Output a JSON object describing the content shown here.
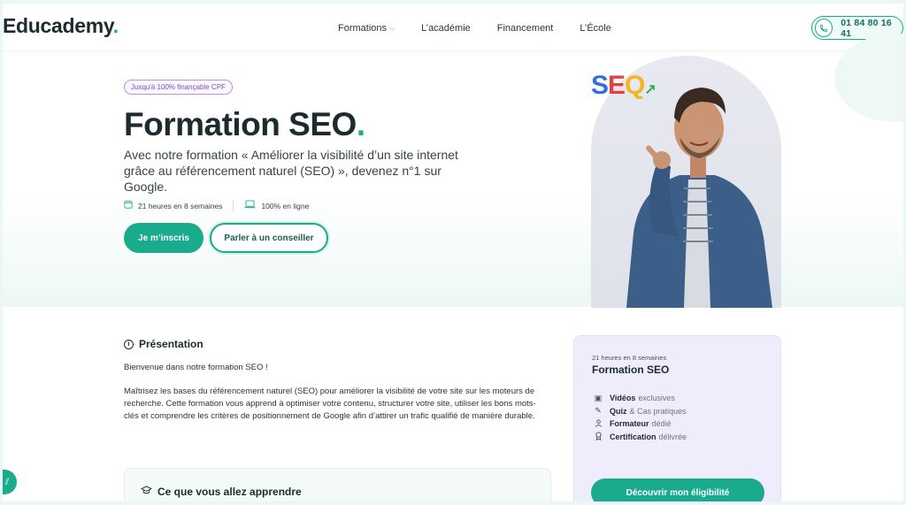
{
  "header": {
    "logo_text": "Educademy",
    "logo_dot": ".",
    "nav": [
      {
        "label": "Formations",
        "has_dropdown": true
      },
      {
        "label": "L’académie"
      },
      {
        "label": "Financement"
      },
      {
        "label": "L’École"
      }
    ],
    "phone_icon": "phone-icon",
    "phone": "01 84 80 16 41"
  },
  "hero": {
    "badge": "Jusqu'à 100% finançable CPF",
    "title": "Formation SEO",
    "title_dot": ".",
    "subtitle": "Avec notre formation « Améliorer la visibilité d’un site internet grâce au référencement naturel (SEO) », devenez n°1 sur Google.",
    "duration": "21 heures en 8 semaines",
    "mode": "100% en ligne",
    "cta_primary": "Je m’inscris",
    "cta_secondary": "Parler à un conseiller",
    "image_logo": {
      "s": "S",
      "e": "E",
      "o": "Q"
    }
  },
  "presentation": {
    "title": "Présentation",
    "intro": "Bienvenue dans notre formation SEO !",
    "body": "Maîtrisez les bases du référencement naturel (SEO) pour améliorer la visibilité de votre site sur les moteurs de recherche. Cette formation vous apprend à optimiser votre contenu, structurer votre site, utiliser les bons mots-clés et comprendre les critères de positionnement de Google afin d’attirer un trafic qualifié de manière durable."
  },
  "learn": {
    "title": "Ce que vous allez apprendre"
  },
  "card": {
    "meta": "21 heures en 8 semaines",
    "title": "Formation SEO",
    "features": [
      {
        "icon": "video-icon",
        "bold": "Vidéos",
        "rest": "exclusives"
      },
      {
        "icon": "pencil-icon",
        "bold": "Quiz",
        "rest": "& Cas pratiques"
      },
      {
        "icon": "user-icon",
        "bold": "Formateur",
        "rest": "dédié"
      },
      {
        "icon": "certificate-icon",
        "bold": "Certification",
        "rest": "délivrée"
      }
    ],
    "cta": "Découvrir mon éligibilité"
  },
  "colors": {
    "accent": "#1aaa8c",
    "badge_purple": "#7e4cc4",
    "card_bg": "#efecfb"
  }
}
